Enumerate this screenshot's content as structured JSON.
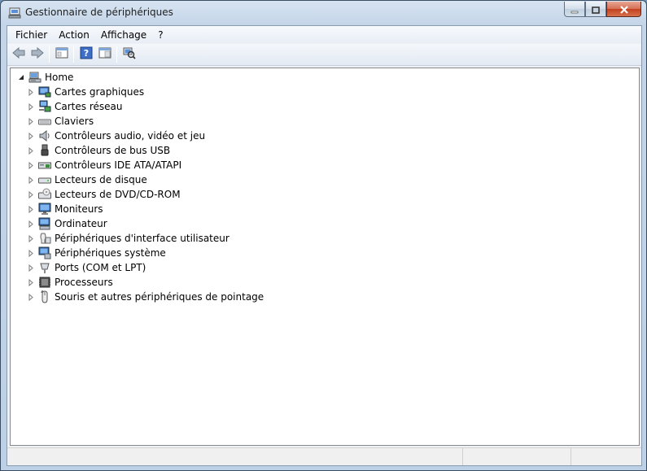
{
  "window": {
    "title": "Gestionnaire de périphériques"
  },
  "menu": [
    {
      "label": "Fichier",
      "name": "menu-fichier"
    },
    {
      "label": "Action",
      "name": "menu-action"
    },
    {
      "label": "Affichage",
      "name": "menu-affichage"
    },
    {
      "label": "?",
      "name": "menu-help"
    }
  ],
  "toolbar": [
    {
      "name": "back-button",
      "icon": "back-arrow-icon"
    },
    {
      "name": "forward-button",
      "icon": "forward-arrow-icon"
    },
    {
      "name": "show-hide-console-tree-button",
      "icon": "console-tree-icon"
    },
    {
      "name": "help-button",
      "icon": "help-icon"
    },
    {
      "name": "properties-pane-button",
      "icon": "properties-pane-icon"
    },
    {
      "name": "scan-hardware-button",
      "icon": "scan-hardware-icon"
    }
  ],
  "tree": {
    "root": {
      "label": "Home",
      "icon": "computer-icon",
      "expanded": true
    },
    "items": [
      {
        "label": "Cartes graphiques",
        "icon": "display-adapter-icon"
      },
      {
        "label": "Cartes réseau",
        "icon": "network-adapter-icon"
      },
      {
        "label": "Claviers",
        "icon": "keyboard-icon"
      },
      {
        "label": "Contrôleurs audio, vidéo et jeu",
        "icon": "speaker-icon"
      },
      {
        "label": "Contrôleurs de bus USB",
        "icon": "usb-icon"
      },
      {
        "label": "Contrôleurs IDE ATA/ATAPI",
        "icon": "ide-controller-icon"
      },
      {
        "label": "Lecteurs de disque",
        "icon": "disk-drive-icon"
      },
      {
        "label": "Lecteurs de DVD/CD-ROM",
        "icon": "dvd-drive-icon"
      },
      {
        "label": "Moniteurs",
        "icon": "monitor-icon"
      },
      {
        "label": "Ordinateur",
        "icon": "computer-icon"
      },
      {
        "label": "Périphériques d'interface utilisateur",
        "icon": "hid-icon"
      },
      {
        "label": "Périphériques système",
        "icon": "system-devices-icon"
      },
      {
        "label": "Ports (COM et LPT)",
        "icon": "port-icon"
      },
      {
        "label": "Processeurs",
        "icon": "processor-icon"
      },
      {
        "label": "Souris et autres périphériques de pointage",
        "icon": "mouse-icon"
      }
    ]
  },
  "colors": {
    "titlebar": "#c4d5e8",
    "close_button": "#c2401f",
    "tree_background": "#ffffff",
    "accent_blue": "#1f5fbf"
  }
}
